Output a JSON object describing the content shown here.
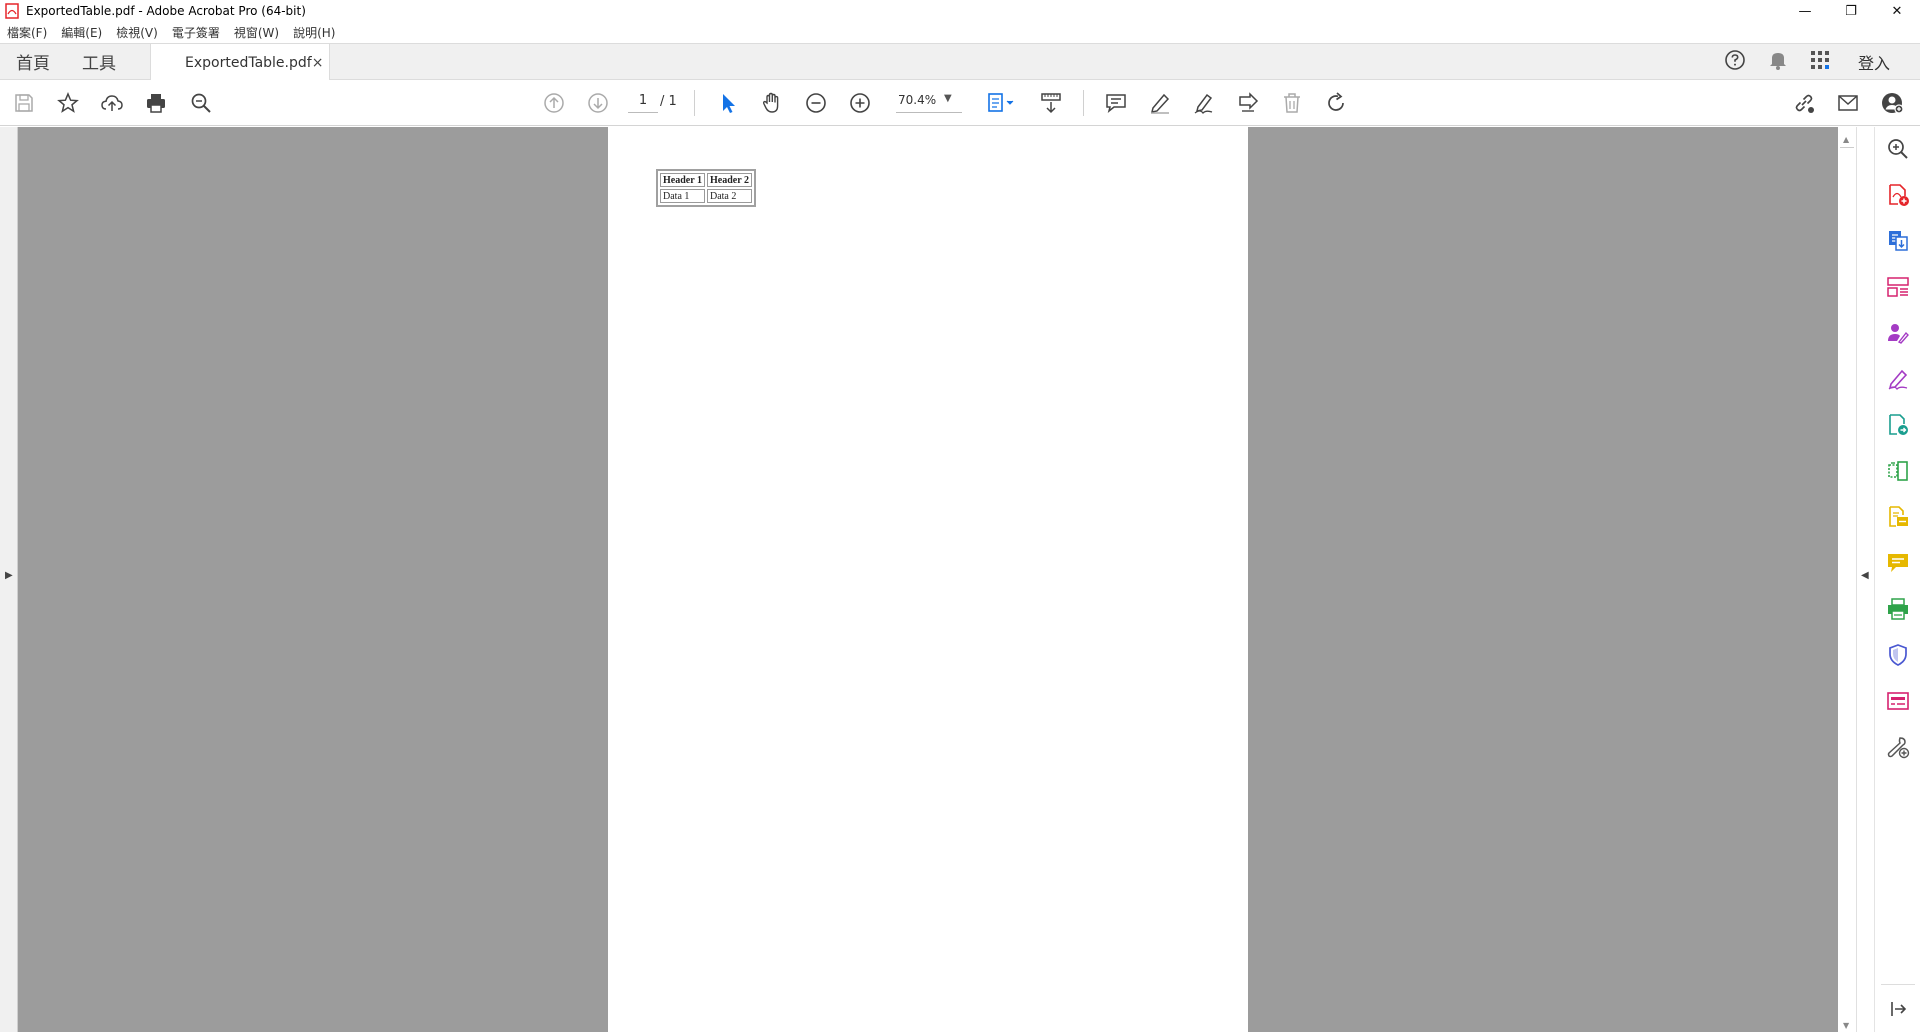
{
  "window": {
    "title": "ExportedTable.pdf - Adobe Acrobat Pro (64-bit)",
    "minimize_label": "—",
    "restore_label": "❐",
    "close_label": "✕"
  },
  "menu": {
    "items": [
      "檔案(F)",
      "編輯(E)",
      "檢視(V)",
      "電子簽署",
      "視窗(W)",
      "說明(H)"
    ]
  },
  "tabs": {
    "home_label": "首頁",
    "tools_label": "工具",
    "document_label": "ExportedTable.pdf",
    "close_glyph": "×",
    "signin_label": "登入"
  },
  "toolbar": {
    "current_page": "1",
    "total_pages": "/ 1",
    "zoom_value": "70.4%",
    "accent_color": "#1473e6"
  },
  "document": {
    "table": {
      "headers": [
        "Header 1",
        "Header 2"
      ],
      "rows": [
        [
          "Data 1",
          "Data 2"
        ]
      ]
    }
  },
  "rail": {
    "icons": [
      "search-zoom-icon",
      "create-pdf-icon",
      "export-pdf-icon",
      "organize-pages-icon",
      "request-signature-icon",
      "fill-sign-icon",
      "edit-pdf-icon",
      "compare-files-icon",
      "scan-ocr-icon",
      "comment-icon",
      "print-production-icon",
      "protect-icon",
      "redact-icon",
      "more-tools-icon",
      "collapse-panel-icon"
    ],
    "colors": {
      "red": "#e5252a",
      "blue": "#2d6fd9",
      "purple": "#a43bc4",
      "teal": "#1a9e8f",
      "green": "#2fa34a",
      "yellow": "#e6b800",
      "indigo": "#4a58d1",
      "pink": "#d6226f",
      "gray": "#555555"
    }
  }
}
